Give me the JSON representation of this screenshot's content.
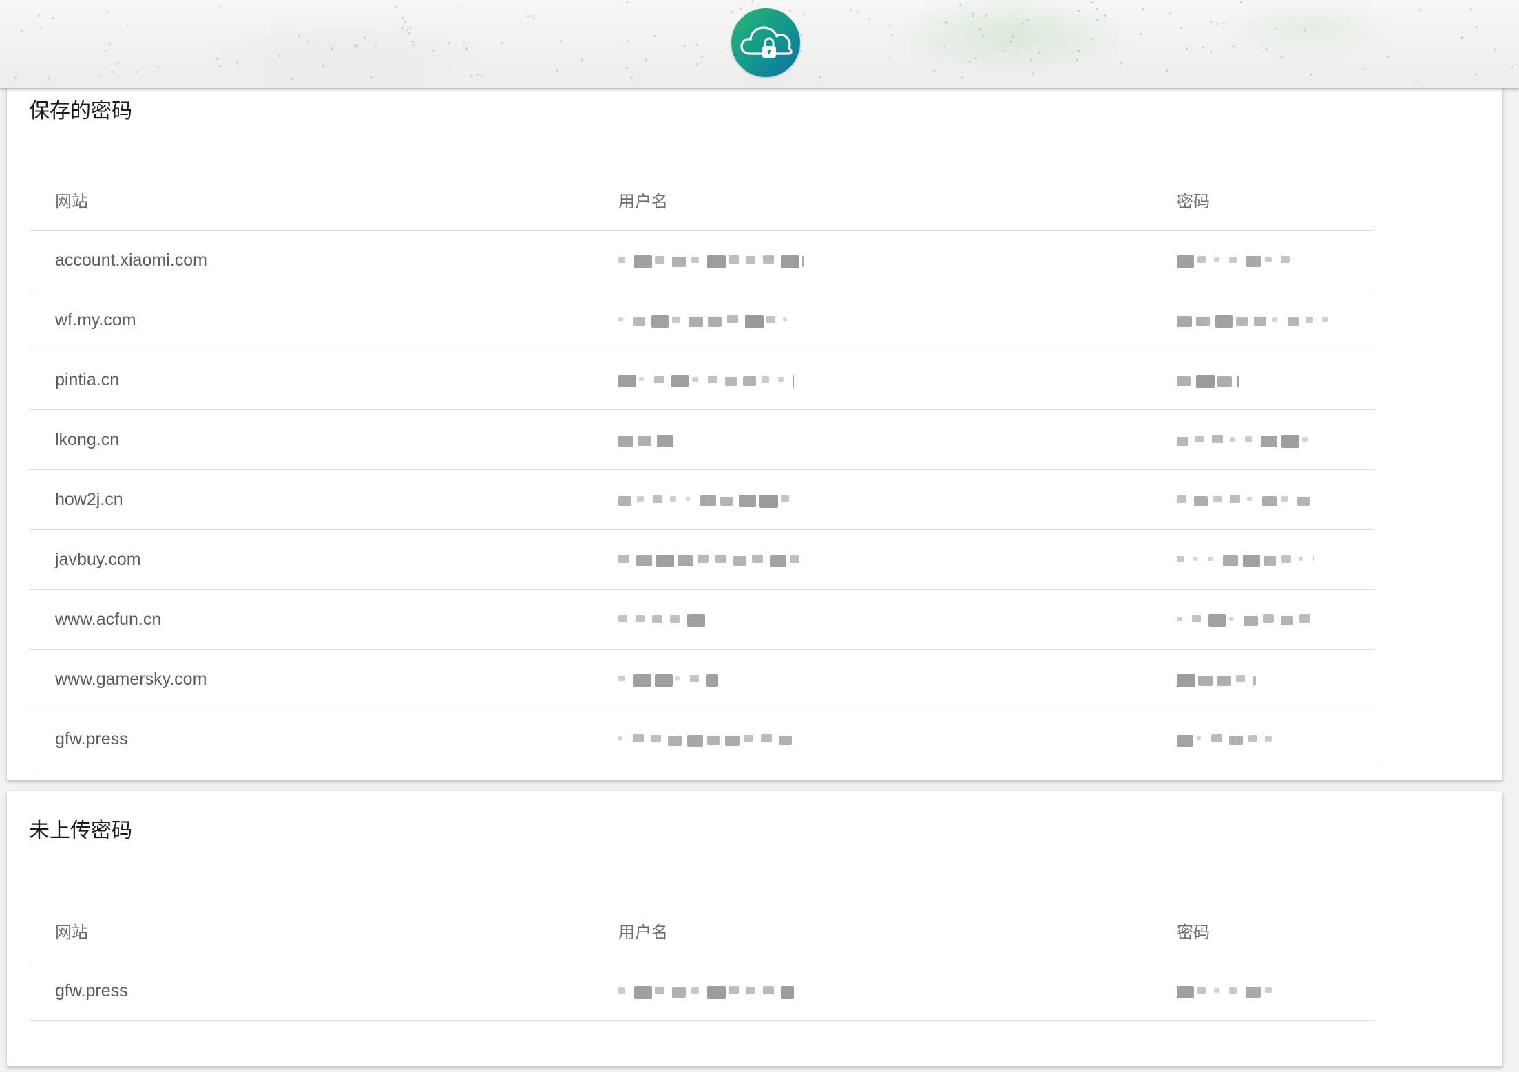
{
  "header": {
    "logo_icon": "cloud-lock-icon"
  },
  "saved": {
    "title": "保存的密码",
    "columns": [
      "网站",
      "用户名",
      "密码"
    ],
    "rows": [
      {
        "site": "account.xiaomi.com",
        "username": "",
        "password": ""
      },
      {
        "site": "wf.my.com",
        "username": "",
        "password": ""
      },
      {
        "site": "pintia.cn",
        "username": "",
        "password": ""
      },
      {
        "site": "lkong.cn",
        "username": "",
        "password": ""
      },
      {
        "site": "how2j.cn",
        "username": "",
        "password": ""
      },
      {
        "site": "javbuy.com",
        "username": "",
        "password": ""
      },
      {
        "site": "www.acfun.cn",
        "username": "",
        "password": ""
      },
      {
        "site": "www.gamersky.com",
        "username": "",
        "password": ""
      },
      {
        "site": "gfw.press",
        "username": "",
        "password": ""
      }
    ]
  },
  "unsynced": {
    "title": "未上传密码",
    "columns": [
      "网站",
      "用户名",
      "密码"
    ],
    "rows": [
      {
        "site": "gfw.press",
        "username": "",
        "password": ""
      }
    ]
  },
  "colors": {
    "logo_start": "#2bb673",
    "logo_end": "#0f6fa6",
    "divider": "#dedede"
  }
}
